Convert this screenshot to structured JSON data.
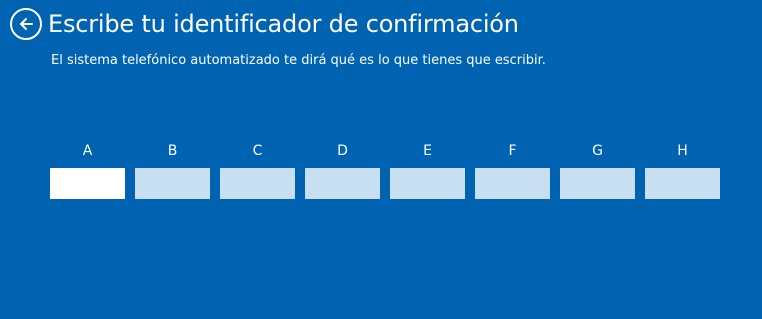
{
  "header": {
    "title": "Escribe tu identificador de confirmación",
    "back_icon": "back-arrow-icon"
  },
  "subtitle": "El sistema telefónico automatizado te dirá qué es lo que tienes que escribir.",
  "fields": [
    {
      "label": "A",
      "value": "",
      "active": true
    },
    {
      "label": "B",
      "value": ""
    },
    {
      "label": "C",
      "value": ""
    },
    {
      "label": "D",
      "value": ""
    },
    {
      "label": "E",
      "value": ""
    },
    {
      "label": "F",
      "value": ""
    },
    {
      "label": "G",
      "value": ""
    },
    {
      "label": "H",
      "value": ""
    }
  ],
  "colors": {
    "background": "#0063b1",
    "text": "#ffffff",
    "inactive_field": "#c7dff1",
    "active_field": "#ffffff"
  }
}
